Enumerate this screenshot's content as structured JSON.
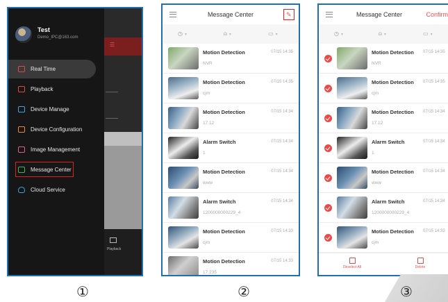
{
  "panel1": {
    "user": {
      "name": "Test",
      "email": "Demo_IPC@163.com"
    },
    "menu": [
      {
        "label": "Real Time",
        "icon": "play-icon",
        "color": "#e24a4a"
      },
      {
        "label": "Playback",
        "icon": "film-icon",
        "color": "#e24a4a"
      },
      {
        "label": "Device Manage",
        "icon": "camera-icon",
        "color": "#3fa6e0"
      },
      {
        "label": "Device Configuration",
        "icon": "settings-icon",
        "color": "#f08a2e"
      },
      {
        "label": "Image Management",
        "icon": "image-icon",
        "color": "#e2608a"
      },
      {
        "label": "Message Center",
        "icon": "message-icon",
        "color": "#3fb65a"
      },
      {
        "label": "Cloud Service",
        "icon": "cloud-icon",
        "color": "#3fa6e0"
      }
    ],
    "active_item": "Real Time",
    "highlighted_item": "Message Center",
    "background_tab_label": "Playback"
  },
  "panel2": {
    "title": "Message Center",
    "messages": [
      {
        "title": "Motion Detection",
        "sub": "NVR",
        "time": "07/15 14:35"
      },
      {
        "title": "Motion Detection",
        "sub": "cjm",
        "time": "07/15 14:35"
      },
      {
        "title": "Motion Detection",
        "sub": "17.12",
        "time": "07/15 14:34"
      },
      {
        "title": "Alarm Switch",
        "sub": "1",
        "time": "07/15 14:34"
      },
      {
        "title": "Motion Detection",
        "sub": "www",
        "time": "07/15 14:34"
      },
      {
        "title": "Alarm Switch",
        "sub": "1200000000229_4",
        "time": "07/15 14:34"
      },
      {
        "title": "Motion Detection",
        "sub": "cjm",
        "time": "07/15 14:33"
      },
      {
        "title": "Motion Detection",
        "sub": "17.235",
        "time": "07/15 14:33"
      }
    ]
  },
  "panel3": {
    "title": "Message Center",
    "confirm_label": "Confirm",
    "messages": [
      {
        "title": "Motion Detection",
        "sub": "NVR",
        "time": "07/15 14:35"
      },
      {
        "title": "Motion Detection",
        "sub": "cjm",
        "time": "07/15 14:35"
      },
      {
        "title": "Motion Detection",
        "sub": "17.12",
        "time": "07/15 14:34"
      },
      {
        "title": "Alarm Switch",
        "sub": "1",
        "time": "07/15 14:34"
      },
      {
        "title": "Motion Detection",
        "sub": "www",
        "time": "07/15 14:34"
      },
      {
        "title": "Alarm Switch",
        "sub": "1200000000229_4",
        "time": "07/15 14:34"
      },
      {
        "title": "Motion Detection",
        "sub": "cjm",
        "time": "07/15 14:33"
      }
    ],
    "bottom": {
      "deselect_label": "Deselect All",
      "delete_label": "Delete"
    }
  },
  "step_labels": [
    "①",
    "②",
    "③"
  ],
  "colors": {
    "accent_red": "#e94b4b",
    "frame_blue": "#1f6fb0",
    "drawer_bg": "#161616"
  }
}
